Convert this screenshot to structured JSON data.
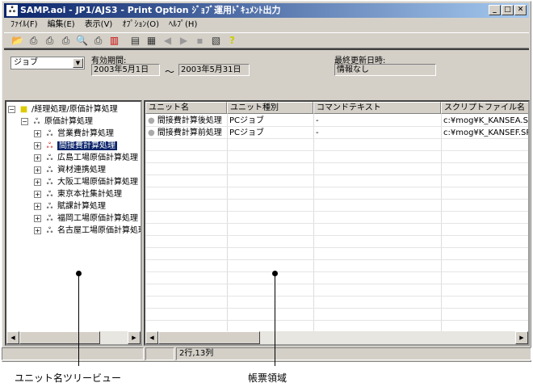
{
  "window": {
    "title": "SAMP.aoi - JP1/AJS3 - Print Option ｼﾞｮﾌﾞ運用ﾄﾞｷｭﾒﾝﾄ出力"
  },
  "menu": [
    "ﾌｧｲﾙ(F)",
    "編集(E)",
    "表示(V)",
    "ｵﾌﾟｼｮﾝ(O)",
    "ﾍﾙﾌﾟ(H)"
  ],
  "filter": {
    "type_select": "ジョブ",
    "period_label": "有効期間:",
    "period_from": "2003年5月1日",
    "tilde": "～",
    "period_to": "2003年5月31日",
    "last_updated_label": "最終更新日時:",
    "last_updated_value": "情報なし"
  },
  "tree": {
    "root": "/経理処理/原価計算処理",
    "group": "原価計算処理",
    "children": [
      "営業費計算処理",
      "間接費計算処理",
      "広島工場原価計算処理",
      "資材連携処理",
      "大阪工場原価計算処理",
      "東京本社集計処理",
      "賦課計算処理",
      "福岡工場原価計算処理",
      "名古屋工場原価計算処理"
    ]
  },
  "grid": {
    "columns": [
      "ユニット名",
      "ユニット種別",
      "コマンドテキスト",
      "スクリプトファイル名"
    ],
    "rows": [
      [
        "間接費計算後処理",
        "PCジョブ",
        "-",
        "c:¥mog¥K_KANSEA.SPT"
      ],
      [
        "間接費計算前処理",
        "PCジョブ",
        "-",
        "c:¥mog¥K_KANSEF.SPT"
      ]
    ]
  },
  "status": {
    "position": "2行,13列"
  },
  "annotations": {
    "tree": "ユニット名ツリービュー",
    "grid": "帳票領域"
  }
}
